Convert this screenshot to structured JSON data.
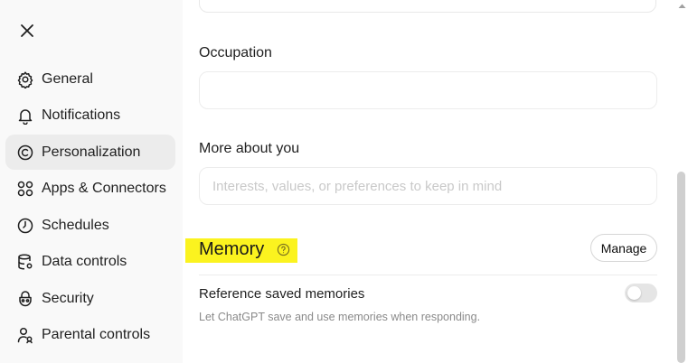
{
  "sidebar": {
    "close_icon": "close-icon",
    "items": [
      {
        "label": "General",
        "icon": "gear-icon",
        "active": false
      },
      {
        "label": "Notifications",
        "icon": "bell-icon",
        "active": false
      },
      {
        "label": "Personalization",
        "icon": "personalization-icon",
        "active": true
      },
      {
        "label": "Apps & Connectors",
        "icon": "apps-icon",
        "active": false
      },
      {
        "label": "Schedules",
        "icon": "clock-icon",
        "active": false
      },
      {
        "label": "Data controls",
        "icon": "database-icon",
        "active": false
      },
      {
        "label": "Security",
        "icon": "shield-icon",
        "active": false
      },
      {
        "label": "Parental controls",
        "icon": "parental-icon",
        "active": false
      }
    ]
  },
  "main": {
    "occupation_label": "Occupation",
    "occupation_value": "",
    "more_about_label": "More about you",
    "more_about_placeholder": "Interests, values, or preferences to keep in mind",
    "memory_title": "Memory",
    "manage_button": "Manage",
    "reference_title": "Reference saved memories",
    "reference_desc": "Let ChatGPT save and use memories when responding.",
    "reference_enabled": false
  },
  "colors": {
    "highlight": "#fbf31f",
    "sidebar_bg": "#f9f9f9",
    "active_item_bg": "#ececec"
  }
}
